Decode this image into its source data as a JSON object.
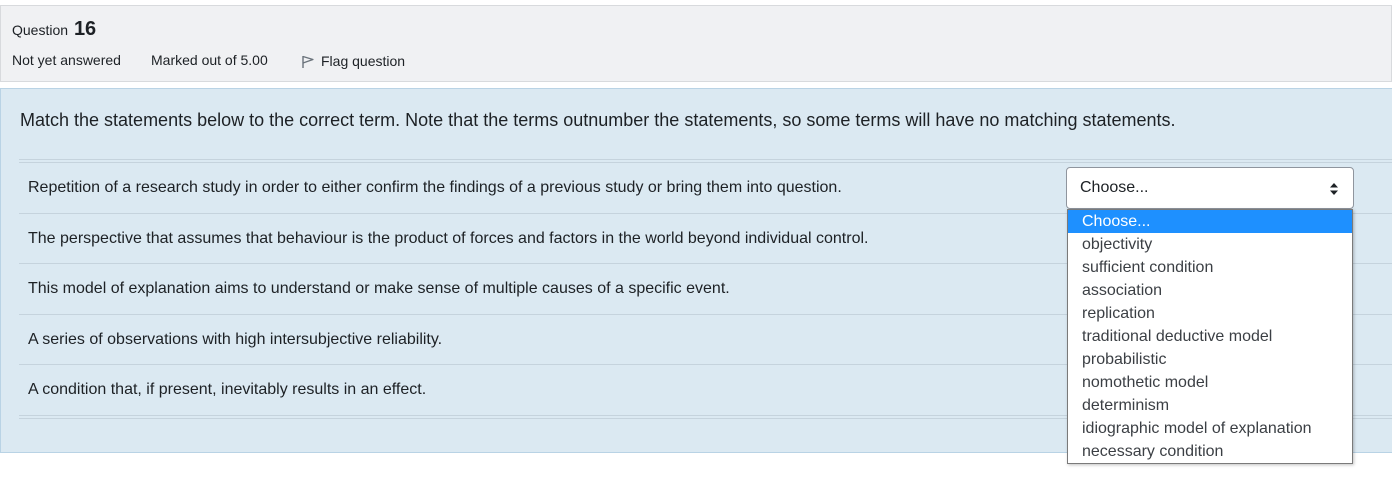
{
  "question_info": {
    "label": "Question",
    "number": "16",
    "state": "Not yet answered",
    "grade": "Marked out of 5.00",
    "flag_label": "Flag question"
  },
  "question_text": "Match the statements below to the correct term. Note that the terms outnumber the statements, so some terms will have no matching statements.",
  "statements": [
    "Repetition of a research study in order to either confirm the findings of a previous study or bring them into question.",
    "The perspective that assumes that behaviour is the product of forces and factors in the world beyond individual control.",
    "This model of explanation aims to understand or make sense of multiple causes of a specific event.",
    "A series of observations with high intersubjective reliability.",
    "A condition that, if present, inevitably results in an effect."
  ],
  "select": {
    "value": "Choose..."
  },
  "dropdown_options": [
    "Choose...",
    "objectivity",
    "sufficient condition",
    "association",
    "replication",
    "traditional deductive model",
    "probabilistic",
    "nomothetic model",
    "determinism",
    "idiographic model of explanation",
    "necessary condition"
  ],
  "colors": {
    "selected_option_bg": "#1e90ff",
    "formulation_bg": "#dbe9f2",
    "info_bg": "#f0f1f3"
  }
}
